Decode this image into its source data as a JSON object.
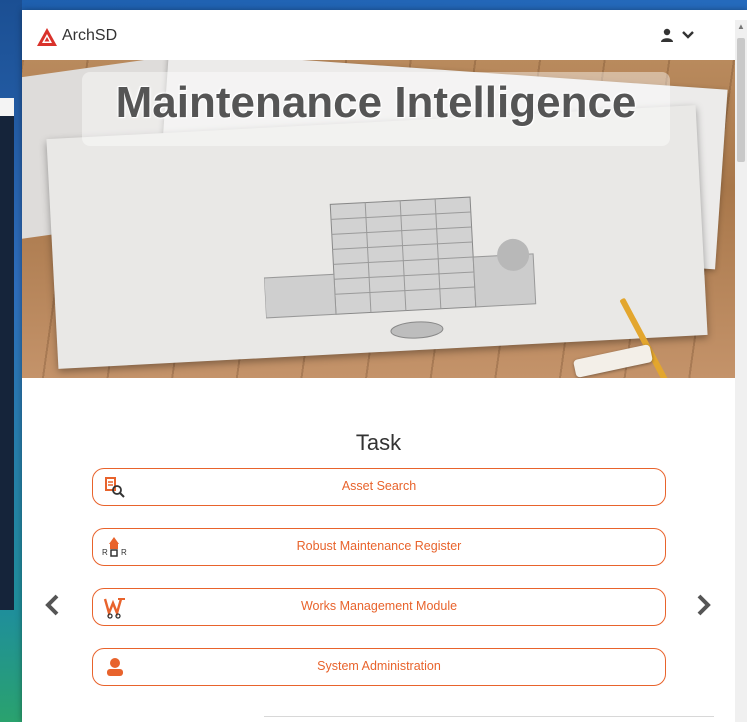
{
  "header": {
    "brand": "ArchSD",
    "user_icon": "user-icon",
    "dropdown_icon": "chevron-down-icon"
  },
  "hero": {
    "title": "Maintenance Intelligence"
  },
  "task_section": {
    "heading": "Task",
    "items": [
      {
        "label": "Asset Search",
        "icon": "asset-search-icon"
      },
      {
        "label": "Robust Maintenance Register",
        "icon": "maintenance-register-icon"
      },
      {
        "label": "Works Management Module",
        "icon": "works-management-icon"
      },
      {
        "label": "System Administration",
        "icon": "admin-user-icon"
      }
    ]
  },
  "nav": {
    "prev_icon": "chevron-left-icon",
    "next_icon": "chevron-right-icon"
  },
  "colors": {
    "accent": "#e8632c",
    "brand_red": "#d9322b"
  }
}
